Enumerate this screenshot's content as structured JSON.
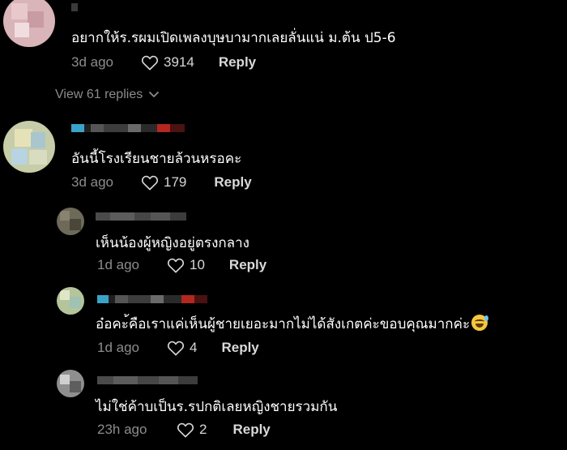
{
  "comments": [
    {
      "text": "อยากให้ร.รผมเปิดเพลงบุษบามากเลยลั่นแน่ ม.ต้น ป5-6",
      "time": "3d ago",
      "likes": "3914",
      "reply_label": "Reply"
    },
    {
      "text": "อันนี้โรงเรียนชายล้วนหรอคะ",
      "time": "3d ago",
      "likes": "179",
      "reply_label": "Reply"
    }
  ],
  "view_replies_label": "View 61 replies",
  "replies": [
    {
      "text": "เห็นน้องผู้หญิงอยู่ตรงกลาง",
      "time": "1d ago",
      "likes": "10",
      "reply_label": "Reply"
    },
    {
      "text": "อ๋อคะ้คือเราแค่เห็นผู้ชายเยอะมากไม่ได้สังเกตค่ะขอบคุณมากค่ะ",
      "emoji": "grinning-face-with-sweat",
      "time": "1d ago",
      "likes": "4",
      "reply_label": "Reply"
    },
    {
      "text": "ไม่ใช่ค้าบเป็นร.รปกติเลยหญิงชายรวมกัน",
      "time": "23h ago",
      "likes": "2",
      "reply_label": "Reply"
    }
  ],
  "colors": {
    "background": "#000000",
    "text": "#ffffff",
    "muted": "#8c8c8c",
    "reply": "#d9d9d9"
  }
}
